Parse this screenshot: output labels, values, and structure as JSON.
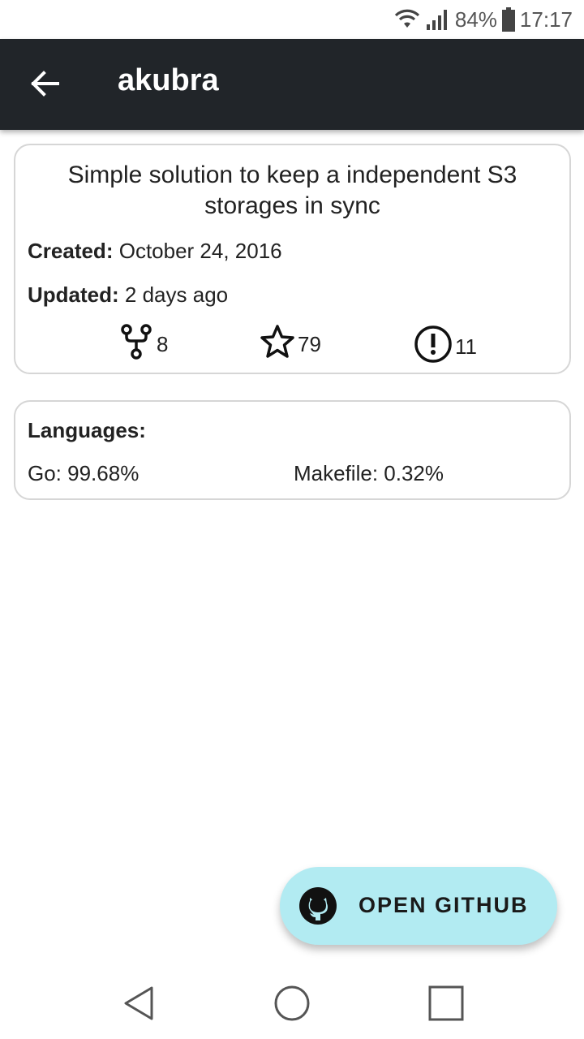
{
  "status_bar": {
    "battery_percent": "84%",
    "time": "17:17"
  },
  "app_bar": {
    "title": "akubra"
  },
  "repo": {
    "description": "Simple solution to keep a independent S3 storages in sync",
    "created_label": "Created:",
    "created_value": "October 24, 2016",
    "updated_label": "Updated:",
    "updated_value": "2 days ago",
    "forks": "8",
    "stars": "79",
    "issues": "11"
  },
  "languages": {
    "heading": "Languages:",
    "items": [
      "Go: 99.68%",
      "Makefile: 0.32%"
    ]
  },
  "fab": {
    "label": "OPEN GITHUB",
    "icon": "github-icon",
    "color": "#b2ebf2"
  },
  "colors": {
    "app_bar": "#212529",
    "card_border": "#d6d6d6"
  }
}
